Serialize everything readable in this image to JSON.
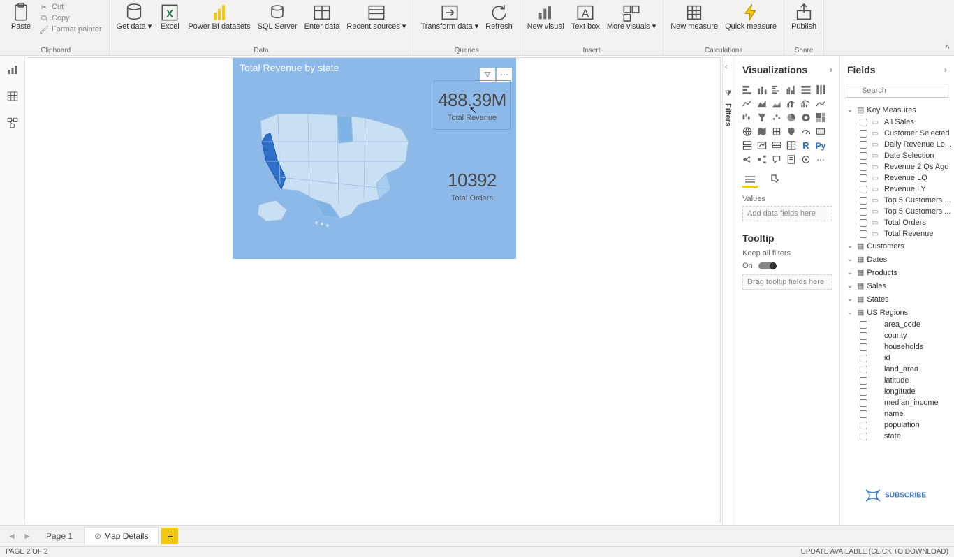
{
  "ribbon": {
    "clipboard": {
      "paste": "Paste",
      "cut": "Cut",
      "copy": "Copy",
      "format_painter": "Format painter",
      "group": "Clipboard"
    },
    "data": {
      "get_data": "Get data",
      "excel": "Excel",
      "pbi_datasets": "Power BI datasets",
      "sql": "SQL Server",
      "enter": "Enter data",
      "recent": "Recent sources",
      "group": "Data"
    },
    "queries": {
      "transform": "Transform data",
      "refresh": "Refresh",
      "group": "Queries"
    },
    "insert": {
      "new_visual": "New visual",
      "text_box": "Text box",
      "more": "More visuals",
      "group": "Insert"
    },
    "calc": {
      "new_measure": "New measure",
      "quick": "Quick measure",
      "group": "Calculations"
    },
    "share": {
      "publish": "Publish",
      "group": "Share"
    }
  },
  "visual": {
    "title": "Total Revenue by state",
    "kpi1_value": "488.39M",
    "kpi1_label": "Total Revenue",
    "kpi2_value": "10392",
    "kpi2_label": "Total Orders"
  },
  "viz_panel": {
    "title": "Visualizations",
    "values_label": "Values",
    "values_placeholder": "Add data fields here",
    "tooltip_title": "Tooltip",
    "keep_filters": "Keep all filters",
    "toggle_on": "On",
    "tooltip_placeholder": "Drag tooltip fields here"
  },
  "filters_label": "Filters",
  "fields_panel": {
    "title": "Fields",
    "search_placeholder": "Search",
    "tables": {
      "key_measures": {
        "name": "Key Measures",
        "fields": [
          "All Sales",
          "Customer Selected",
          "Daily Revenue Lo...",
          "Date Selection",
          "Revenue 2 Qs Ago",
          "Revenue LQ",
          "Revenue LY",
          "Top 5 Customers ...",
          "Top 5 Customers ...",
          "Total Orders",
          "Total Revenue"
        ]
      },
      "customers": {
        "name": "Customers"
      },
      "dates": {
        "name": "Dates"
      },
      "products": {
        "name": "Products"
      },
      "sales": {
        "name": "Sales"
      },
      "states": {
        "name": "States"
      },
      "us_regions": {
        "name": "US Regions",
        "fields": [
          "area_code",
          "county",
          "households",
          "id",
          "land_area",
          "latitude",
          "longitude",
          "median_income",
          "name",
          "population",
          "state"
        ]
      }
    }
  },
  "pages": {
    "page1": "Page 1",
    "page2": "Map Details"
  },
  "status": {
    "left": "PAGE 2 OF 2",
    "right": "UPDATE AVAILABLE (CLICK TO DOWNLOAD)"
  },
  "dna_badge": "SUBSCRIBE"
}
